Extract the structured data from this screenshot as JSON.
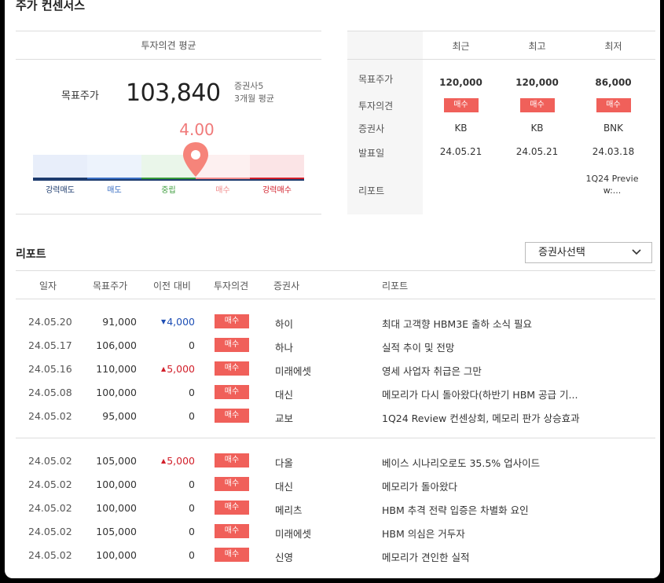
{
  "section": {
    "title": "주가 컨센서스"
  },
  "consensus": {
    "header": "투자의견 평균",
    "target_label": "목표주가",
    "target_value": "103,840",
    "firms_count": "증권사5",
    "period": "3개월 평균",
    "score": "4.00",
    "score_value": 4.0,
    "gauge_labels": [
      "강력매도",
      "매도",
      "중립",
      "매수",
      "강력매수"
    ],
    "gauge_colors": [
      "#1d3b6e",
      "#3b6fc4",
      "#3a9b3a",
      "#f08a8a",
      "#d21f2a"
    ]
  },
  "summary_table": {
    "columns": [
      "최근",
      "최고",
      "최저"
    ],
    "row_labels": [
      "목표주가",
      "투자의견",
      "증권사",
      "발표일",
      "리포트"
    ],
    "target": [
      "120,000",
      "120,000",
      "86,000"
    ],
    "opinion": [
      "매수",
      "매수",
      "매수"
    ],
    "firm": [
      "KB",
      "KB",
      "BNK"
    ],
    "date": [
      "24.05.21",
      "24.05.21",
      "24.03.18"
    ],
    "report": [
      "",
      "",
      "1Q24 Preview:..."
    ]
  },
  "reports": {
    "title": "리포트",
    "select_label": "증권사선택",
    "headers": [
      "일자",
      "목표주가",
      "이전 대비",
      "투자의견",
      "증권사",
      "리포트"
    ],
    "rows": [
      {
        "date": "24.05.20",
        "target": "91,000",
        "dir": "down",
        "change": "4,000",
        "opinion": "매수",
        "firm": "하이",
        "title": "최대 고객향 HBM3E 출하 소식 필요"
      },
      {
        "date": "24.05.17",
        "target": "106,000",
        "dir": "",
        "change": "0",
        "opinion": "매수",
        "firm": "하나",
        "title": "실적 추이 및 전망"
      },
      {
        "date": "24.05.16",
        "target": "110,000",
        "dir": "up",
        "change": "5,000",
        "opinion": "매수",
        "firm": "미래에셋",
        "title": "영세 사업자 취급은 그만"
      },
      {
        "date": "24.05.08",
        "target": "100,000",
        "dir": "",
        "change": "0",
        "opinion": "매수",
        "firm": "대신",
        "title": "메모리가 다시 돌아왔다(하반기 HBM 공급 기..."
      },
      {
        "date": "24.05.02",
        "target": "95,000",
        "dir": "",
        "change": "0",
        "opinion": "매수",
        "firm": "교보",
        "title": "1Q24 Review 컨센상회, 메모리 판가 상승효과"
      },
      {
        "date": "24.05.02",
        "target": "105,000",
        "dir": "up",
        "change": "5,000",
        "opinion": "매수",
        "firm": "다올",
        "title": "베이스 시나리오로도 35.5% 업사이드"
      },
      {
        "date": "24.05.02",
        "target": "100,000",
        "dir": "",
        "change": "0",
        "opinion": "매수",
        "firm": "대신",
        "title": "메모리가 돌아왔다"
      },
      {
        "date": "24.05.02",
        "target": "100,000",
        "dir": "",
        "change": "0",
        "opinion": "매수",
        "firm": "메리츠",
        "title": "HBM 추격 전략 입증은 차별화 요인"
      },
      {
        "date": "24.05.02",
        "target": "105,000",
        "dir": "",
        "change": "0",
        "opinion": "매수",
        "firm": "미래에셋",
        "title": "HBM 의심은 거두자"
      },
      {
        "date": "24.05.02",
        "target": "100,000",
        "dir": "",
        "change": "0",
        "opinion": "매수",
        "firm": "신영",
        "title": "메모리가 견인한 실적"
      }
    ]
  }
}
